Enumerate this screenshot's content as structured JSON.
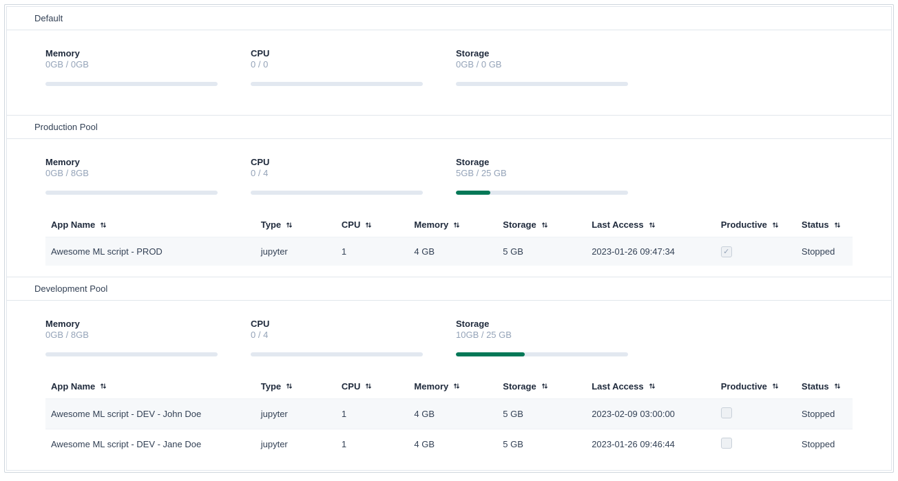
{
  "columns": {
    "app_name": "App Name",
    "type": "Type",
    "cpu": "CPU",
    "memory": "Memory",
    "storage": "Storage",
    "last_access": "Last Access",
    "productive": "Productive",
    "status": "Status"
  },
  "metric_labels": {
    "memory": "Memory",
    "cpu": "CPU",
    "storage": "Storage"
  },
  "pools": [
    {
      "name": "Default",
      "metrics": {
        "memory": {
          "text": "0GB / 0GB",
          "pct": 0
        },
        "cpu": {
          "text": "0 / 0",
          "pct": 0
        },
        "storage": {
          "text": "0GB / 0 GB",
          "pct": 0
        }
      },
      "has_table": false,
      "rows": []
    },
    {
      "name": "Production Pool",
      "metrics": {
        "memory": {
          "text": "0GB / 8GB",
          "pct": 0
        },
        "cpu": {
          "text": "0 / 4",
          "pct": 0
        },
        "storage": {
          "text": "5GB / 25 GB",
          "pct": 20
        }
      },
      "has_table": true,
      "rows": [
        {
          "app_name": "Awesome ML script - PROD",
          "type": "jupyter",
          "cpu": "1",
          "memory": "4 GB",
          "storage": "5 GB",
          "last_access": "2023-01-26 09:47:34",
          "productive": true,
          "status": "Stopped"
        }
      ]
    },
    {
      "name": "Development Pool",
      "metrics": {
        "memory": {
          "text": "0GB / 8GB",
          "pct": 0
        },
        "cpu": {
          "text": "0 / 4",
          "pct": 0
        },
        "storage": {
          "text": "10GB / 25 GB",
          "pct": 40
        }
      },
      "has_table": true,
      "rows": [
        {
          "app_name": "Awesome ML script - DEV - John Doe",
          "type": "jupyter",
          "cpu": "1",
          "memory": "4 GB",
          "storage": "5 GB",
          "last_access": "2023-02-09 03:00:00",
          "productive": false,
          "status": "Stopped"
        },
        {
          "app_name": "Awesome ML script - DEV - Jane Doe",
          "type": "jupyter",
          "cpu": "1",
          "memory": "4 GB",
          "storage": "5 GB",
          "last_access": "2023-01-26 09:46:44",
          "productive": false,
          "status": "Stopped"
        }
      ]
    }
  ]
}
